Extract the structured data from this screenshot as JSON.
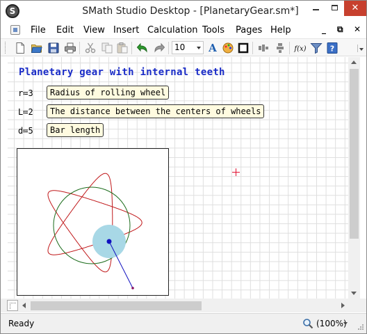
{
  "window": {
    "title": "SMath Studio Desktop - [PlanetaryGear.sm*]",
    "app_icon_letter": "S",
    "close_glyph": "✕"
  },
  "menu": {
    "items": [
      "File",
      "Edit",
      "View",
      "Insert",
      "Calculation",
      "Tools",
      "Pages",
      "Help"
    ],
    "mdi_minimize": "_",
    "mdi_restore": "⧉",
    "mdi_close": "✕"
  },
  "toolbar": {
    "font_size": "10",
    "fx_label": "f(x)",
    "icons": [
      "new-document-icon",
      "open-folder-icon",
      "save-icon",
      "print-icon",
      "cut-icon",
      "copy-icon",
      "paste-icon",
      "undo-icon",
      "redo-icon",
      "text-color-icon",
      "fill-color-icon",
      "border-icon",
      "align-horizontal-icon",
      "align-vertical-icon",
      "function-icon",
      "filter-icon",
      "help-icon"
    ]
  },
  "sheet": {
    "title": "Planetary gear with internal teeth",
    "definitions": [
      {
        "var": "r",
        "assign": "≔",
        "value": "3",
        "comment": "Radius of rolling wheel"
      },
      {
        "var": "L",
        "assign": "≔",
        "value": "2",
        "comment": "The distance between the centers of wheels"
      },
      {
        "var": "d",
        "assign": "≔",
        "value": "5",
        "comment": "Bar length"
      }
    ]
  },
  "plot": {
    "type": "hypotrochoid",
    "curve_color": "#c0181a",
    "circle_color": "#1a6b1a",
    "disk_color": "#a8d8e6",
    "bar_color": "#1010c0",
    "tip_color": "#8a1060"
  },
  "colors": {
    "title_blue": "#1a2cc7",
    "comment_bg": "#fffbe0",
    "cursor_red": "#e01030",
    "close_red": "#c7402e"
  },
  "status": {
    "text": "Ready",
    "zoom": "(100%)"
  }
}
